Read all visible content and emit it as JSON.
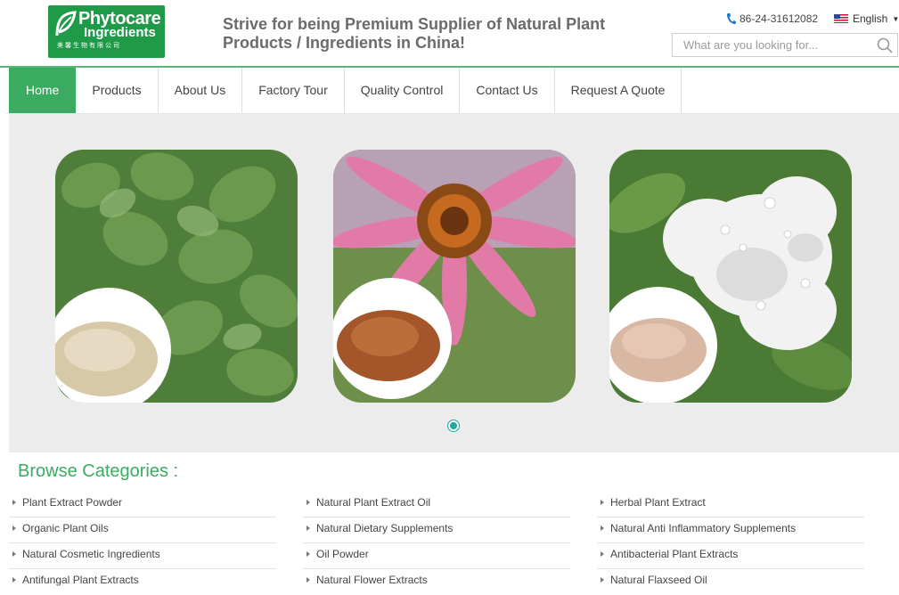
{
  "header": {
    "logo": {
      "line1": "Phytocare",
      "line2": "Ingredients",
      "line3": "美馨生物有限公司",
      "color": "#1f9a48"
    },
    "tagline": "Strive for being Premium Supplier of Natural Plant Products / Ingredients in China!",
    "phone": {
      "icon": "phone-icon",
      "number": "86-24-31612082"
    },
    "language": {
      "icon": "us-flag-icon",
      "label": "English"
    },
    "search": {
      "placeholder": "What are you looking for...",
      "icon": "search-icon"
    }
  },
  "nav": {
    "items": [
      {
        "label": "Home",
        "active": true
      },
      {
        "label": "Products"
      },
      {
        "label": "About Us"
      },
      {
        "label": "Factory Tour"
      },
      {
        "label": "Quality Control"
      },
      {
        "label": "Contact Us"
      },
      {
        "label": "Request A Quote"
      }
    ],
    "accent": "#3aab60"
  },
  "slider": {
    "slides": [
      {
        "name": "green-leaves-with-powder"
      },
      {
        "name": "echinacea-flower-with-powder"
      },
      {
        "name": "white-peony-with-powder"
      }
    ],
    "current_slide": 1,
    "slide_count": 1
  },
  "browse": {
    "title": "Browse Categories :",
    "columns": [
      [
        "Plant Extract Powder",
        "Organic Plant Oils",
        "Natural Cosmetic Ingredients",
        "Antifungal Plant Extracts"
      ],
      [
        "Natural Plant Extract Oil",
        "Natural Dietary Supplements",
        "Oil Powder",
        "Natural Flower Extracts"
      ],
      [
        "Herbal Plant Extract",
        "Natural Anti Inflammatory Supplements",
        "Antibacterial Plant Extracts",
        "Natural Flaxseed Oil"
      ]
    ]
  }
}
